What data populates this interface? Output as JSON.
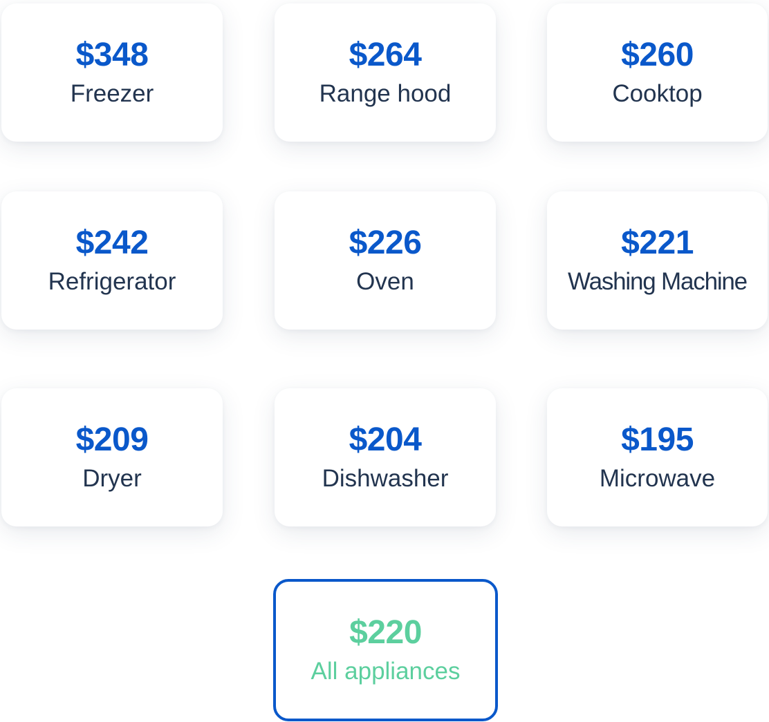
{
  "appliances": [
    {
      "price": "$348",
      "name": "Freezer"
    },
    {
      "price": "$264",
      "name": "Range hood"
    },
    {
      "price": "$260",
      "name": "Cooktop"
    },
    {
      "price": "$242",
      "name": "Refrigerator"
    },
    {
      "price": "$226",
      "name": "Oven"
    },
    {
      "price": "$221",
      "name": "Washing Machine"
    },
    {
      "price": "$209",
      "name": "Dryer"
    },
    {
      "price": "$204",
      "name": "Dishwasher"
    },
    {
      "price": "$195",
      "name": "Microwave"
    }
  ],
  "total": {
    "price": "$220",
    "name": "All appliances"
  },
  "colors": {
    "price_blue": "#0a58ca",
    "label_dark": "#22344f",
    "total_green": "#5ccf9e",
    "total_border": "#0a58ca"
  }
}
